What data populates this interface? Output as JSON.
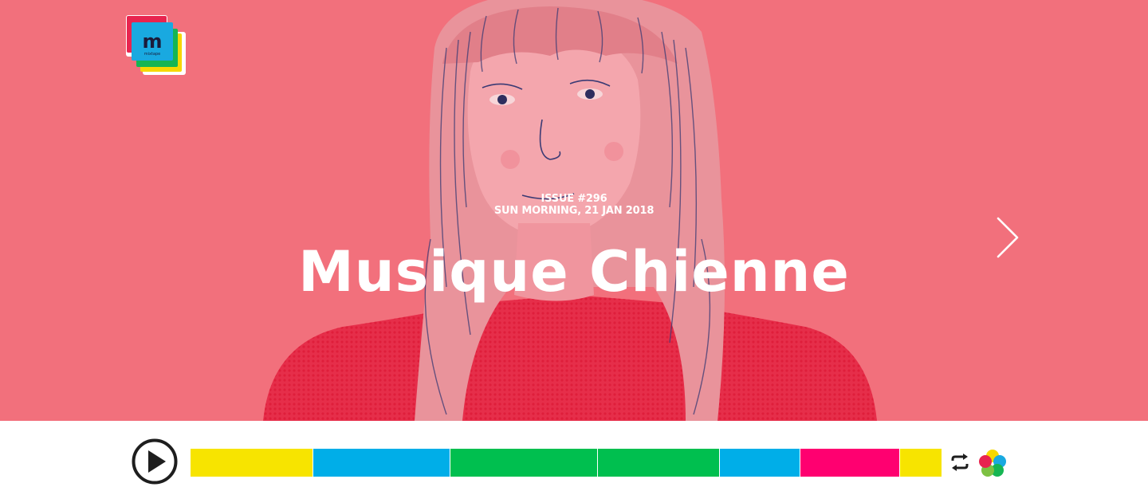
{
  "hero": {
    "issue_number": "ISSUE #296",
    "issue_date": "SUN MORNING, 21 JAN 2018",
    "title": "Musique Chienne",
    "background_color": "#f2707c",
    "illustration": "portrait-illustration"
  },
  "logo": {
    "letter": "m",
    "caption": "mixtape",
    "colors": [
      "#e8244f",
      "#19a9e0",
      "#16b553",
      "#f6d800"
    ]
  },
  "navigation": {
    "next_icon": "chevron-right-icon"
  },
  "player": {
    "play_icon": "play-icon",
    "repeat_icon": "repeat-icon",
    "brand_icon": "flower-icon",
    "tracks": [
      {
        "color": "#f7e400",
        "share": 0.164
      },
      {
        "color": "#00aee8",
        "share": 0.182
      },
      {
        "color": "#00bf4f",
        "share": 0.197
      },
      {
        "color": "#00bf4f",
        "share": 0.162
      },
      {
        "color": "#00aee8",
        "share": 0.107
      },
      {
        "color": "#ff0070",
        "share": 0.133
      },
      {
        "color": "#f7e400",
        "share": 0.055
      }
    ]
  }
}
